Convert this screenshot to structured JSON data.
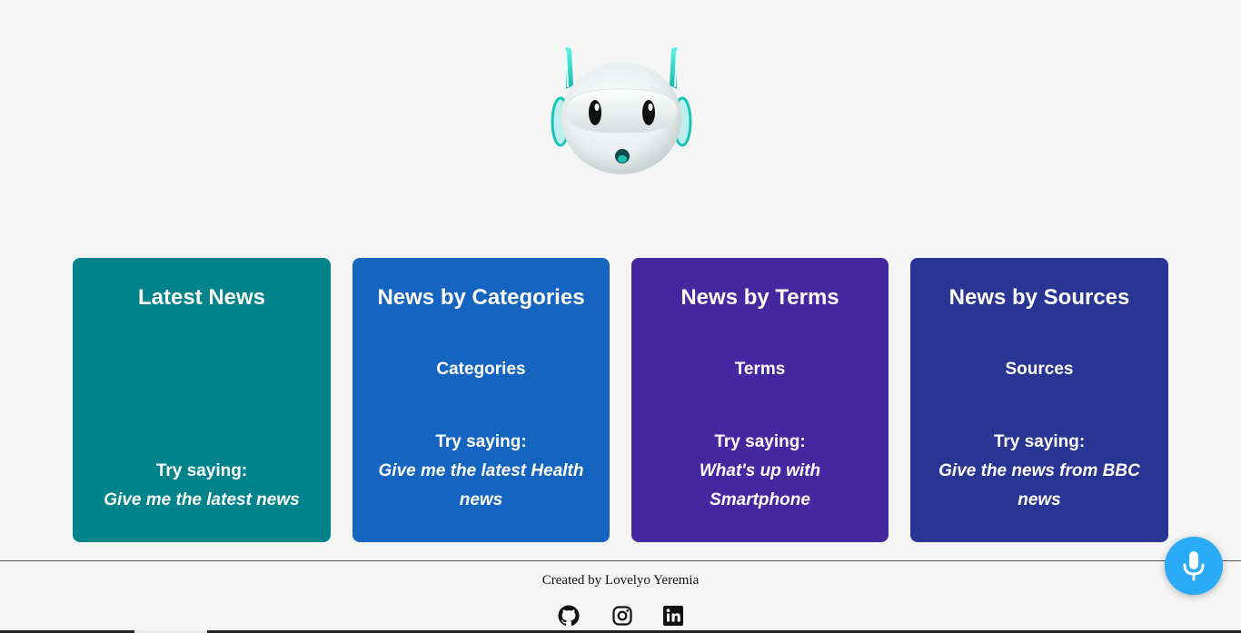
{
  "logo": {
    "icon": "robot-mascot-icon"
  },
  "cards": [
    {
      "title": "Latest News",
      "subtitle": "",
      "try_label": "Try saying:",
      "example": "Give me the latest news",
      "color": "#00838a"
    },
    {
      "title": "News by Categories",
      "subtitle": "Categories",
      "try_label": "Try saying:",
      "example": "Give me the latest Health news",
      "color": "#1565c0"
    },
    {
      "title": "News by Terms",
      "subtitle": "Terms",
      "try_label": "Try saying:",
      "example": "What's up with Smartphone",
      "color": "#4527a0"
    },
    {
      "title": "News by Sources",
      "subtitle": "Sources",
      "try_label": "Try saying:",
      "example": "Give the news from BBC news",
      "color": "#283593"
    }
  ],
  "footer": {
    "credit": "Created by Lovelyo Yeremia",
    "social_icons": [
      "github-icon",
      "instagram-icon",
      "linkedin-icon"
    ]
  },
  "mic_button": {
    "icon": "microphone-icon",
    "color": "#29abf7"
  }
}
